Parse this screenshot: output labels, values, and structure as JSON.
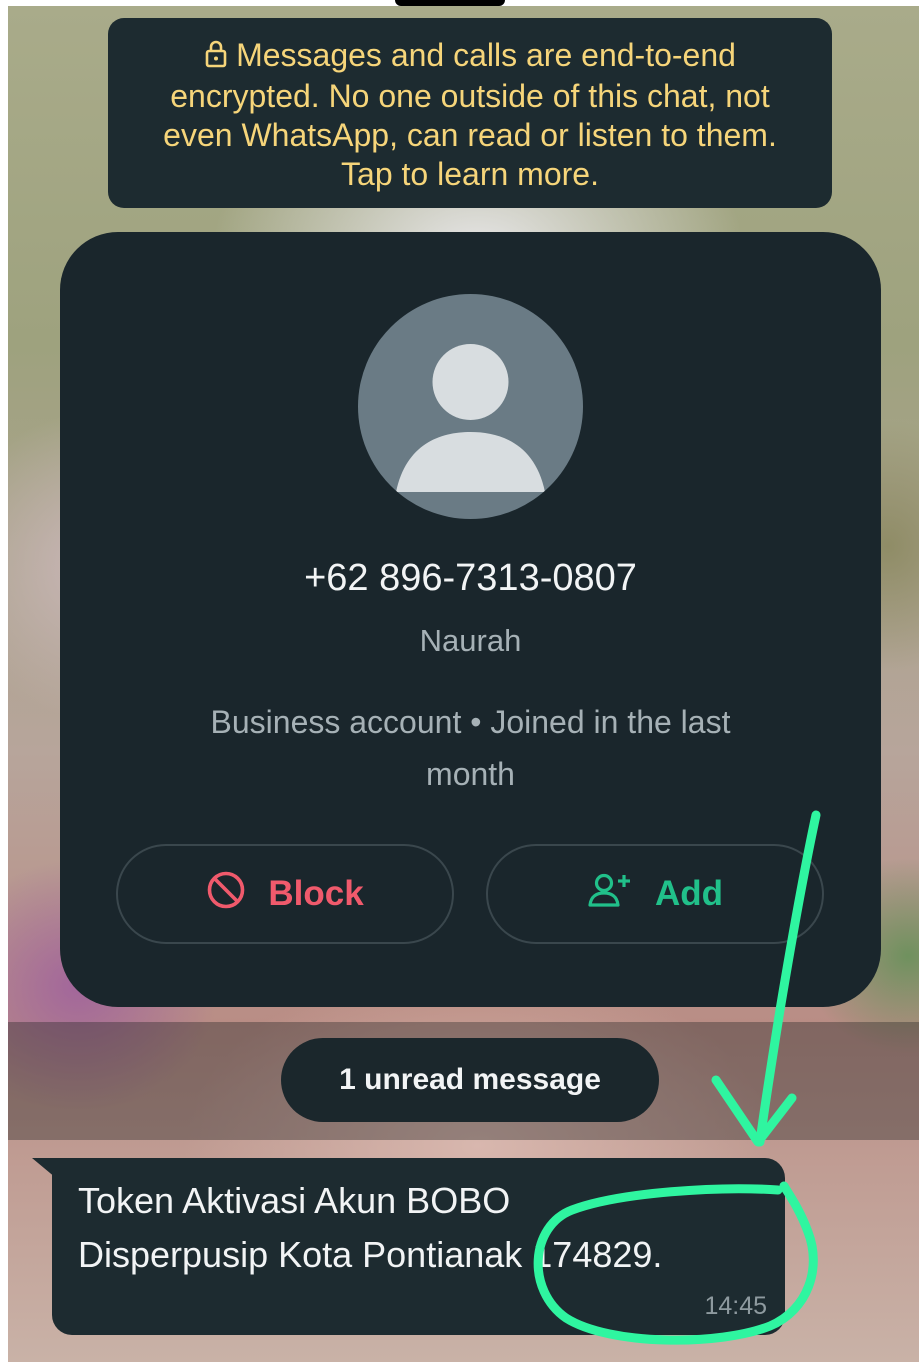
{
  "encryption_notice": {
    "line1": "Messages and calls are end-to-end",
    "line2": "encrypted. No one outside of this chat, not",
    "line3": "even WhatsApp, can read or listen to them.",
    "line4": "Tap to learn more.",
    "icon": "lock-icon",
    "text_color": "#f6d57a"
  },
  "contact": {
    "phone": "+62 896-7313-0807",
    "name": "Naurah",
    "info_line1": "Business account • Joined in the last",
    "info_line2": "month",
    "avatar_icon": "person-icon"
  },
  "actions": {
    "block_label": "Block",
    "block_icon": "block-icon",
    "block_color": "#f05a6c",
    "add_label": "Add",
    "add_icon": "add-person-icon",
    "add_color": "#21c08a"
  },
  "unread": {
    "label": "1 unread message"
  },
  "message": {
    "line1": "Token Aktivasi Akun BOBO",
    "line2": "Disperpusip Kota Pontianak 174829.",
    "time": "14:45"
  },
  "annotation": {
    "color": "#2ff5a0",
    "shapes": [
      "arrow",
      "circle"
    ]
  }
}
